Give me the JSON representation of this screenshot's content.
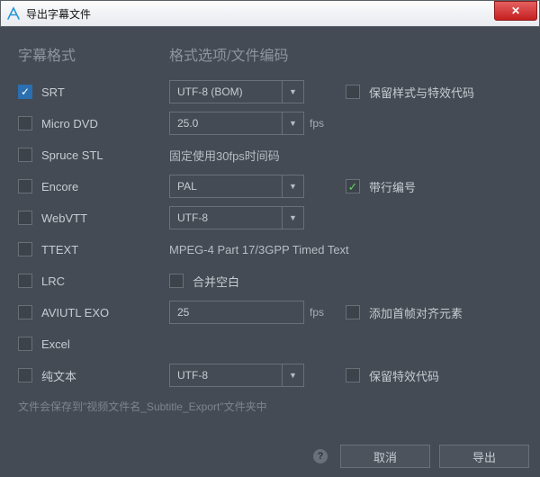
{
  "title": "导出字幕文件",
  "headers": {
    "format": "字幕格式",
    "options": "格式选项/文件编码"
  },
  "formats": {
    "srt": "SRT",
    "microdvd": "Micro DVD",
    "sprucestl": "Spruce STL",
    "encore": "Encore",
    "webvtt": "WebVTT",
    "ttext": "TTEXT",
    "lrc": "LRC",
    "aviutl": "AVIUTL EXO",
    "excel": "Excel",
    "plaintext": "纯文本"
  },
  "opts": {
    "srt_enc": "UTF-8 (BOM)",
    "srt_keepstyle": "保留样式与特效代码",
    "microdvd_fps": "25.0",
    "fps_unit": "fps",
    "spruce_fixed": "固定使用30fps时间码",
    "encore_std": "PAL",
    "encore_linenum": "带行编号",
    "webvtt_enc": "UTF-8",
    "ttext_desc": "MPEG-4 Part 17/3GPP Timed Text",
    "lrc_merge": "合并空白",
    "aviutl_fps": "25",
    "aviutl_addframe": "添加首帧对齐元素",
    "plain_enc": "UTF-8",
    "plain_keepfx": "保留特效代码"
  },
  "note": "文件会保存到\"视频文件名_Subtitle_Export\"文件夹中",
  "buttons": {
    "cancel": "取消",
    "export": "导出"
  }
}
